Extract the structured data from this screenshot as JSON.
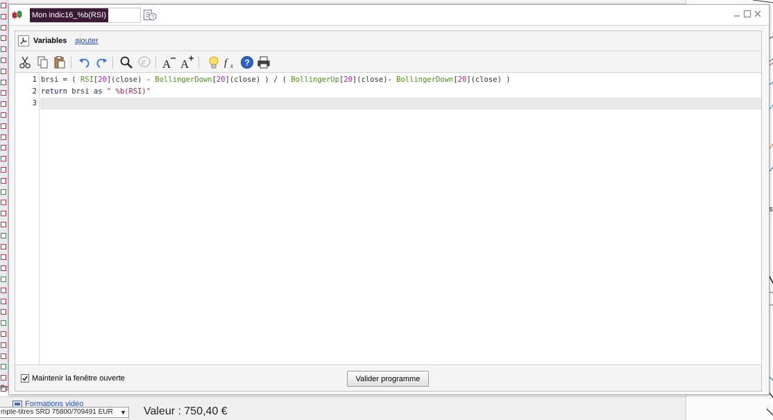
{
  "window": {
    "title": "Mon indic16_%b(RSI)",
    "controls": {
      "minimize": "minimize-icon",
      "maximize": "maximize-icon",
      "close": "close-icon"
    }
  },
  "variables": {
    "label": "Variables",
    "add_link": "ajouter"
  },
  "toolbar": {
    "icons": [
      "cut-icon",
      "copy-icon",
      "paste-icon",
      "undo-icon",
      "redo-icon",
      "search-icon",
      "comment-icon",
      "decrease-font-icon",
      "increase-font-icon",
      "lightbulb-icon",
      "function-icon",
      "help-icon",
      "print-icon"
    ]
  },
  "editor": {
    "lines": [
      {
        "number": "1",
        "tokens": [
          {
            "t": "brsi = ( ",
            "c": "op"
          },
          {
            "t": "RSI",
            "c": "fn"
          },
          {
            "t": "[",
            "c": "op"
          },
          {
            "t": "20",
            "c": "num"
          },
          {
            "t": "](close) - ",
            "c": "op"
          },
          {
            "t": "BollingerDown",
            "c": "fn"
          },
          {
            "t": "[",
            "c": "op"
          },
          {
            "t": "20",
            "c": "num"
          },
          {
            "t": "](close) ) / ( ",
            "c": "op"
          },
          {
            "t": "BollingerUp",
            "c": "fn"
          },
          {
            "t": "[",
            "c": "op"
          },
          {
            "t": "20",
            "c": "num"
          },
          {
            "t": "](close)- ",
            "c": "op"
          },
          {
            "t": "BollingerDown",
            "c": "fn"
          },
          {
            "t": "[",
            "c": "op"
          },
          {
            "t": "20",
            "c": "num"
          },
          {
            "t": "](close) )",
            "c": "op"
          }
        ]
      },
      {
        "number": "2",
        "tokens": [
          {
            "t": "return",
            "c": "kw"
          },
          {
            "t": " brsi ",
            "c": "op"
          },
          {
            "t": "as",
            "c": "kw"
          },
          {
            "t": " ",
            "c": "op"
          },
          {
            "t": "\" %b(RSI)\"",
            "c": "str"
          }
        ]
      },
      {
        "number": "3",
        "tokens": []
      }
    ]
  },
  "footer": {
    "keep_open_label": "Maintenir la fenêtre ouverte",
    "keep_open_checked": true,
    "validate_label": "Valider programme"
  },
  "background": {
    "formations_link": "Formations vidéo",
    "valeur_text": "Valeur : 750,40 €",
    "account_select": "mpte-titres SRD 75800/709491 EUR",
    "left_fragment": "Pe",
    "right_fragment": "ps"
  },
  "colors": {
    "title_bg": "#3a1a34",
    "keyword": "#22228a",
    "function": "#4e8f1a",
    "number": "#b21cb2",
    "string": "#a4206a",
    "link": "#1a4fc4"
  }
}
